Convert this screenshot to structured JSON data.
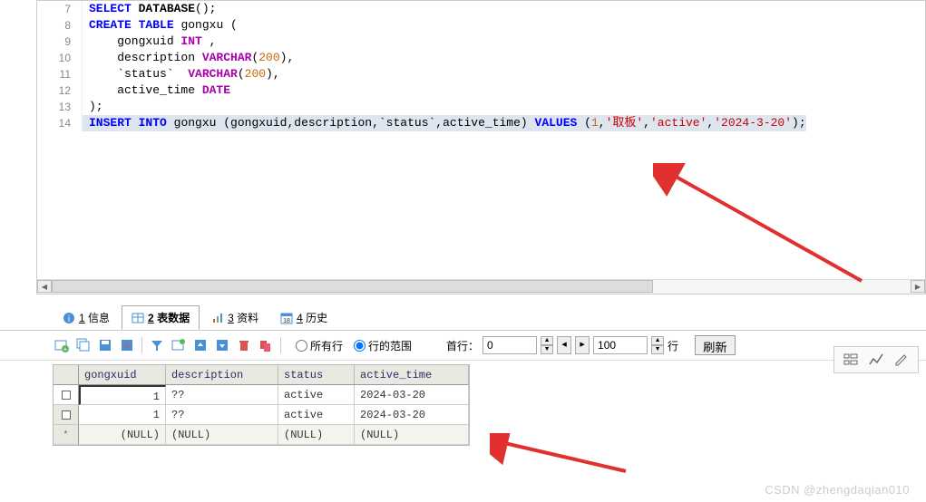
{
  "editor": {
    "lines": [
      {
        "n": 7,
        "segs": [
          {
            "c": "kw",
            "t": "SELECT"
          },
          {
            "t": " "
          },
          {
            "c": "fn",
            "t": "DATABASE"
          },
          {
            "t": "();"
          }
        ]
      },
      {
        "n": 8,
        "segs": [
          {
            "c": "kw",
            "t": "CREATE"
          },
          {
            "t": " "
          },
          {
            "c": "kw",
            "t": "TABLE"
          },
          {
            "t": " gongxu ("
          }
        ]
      },
      {
        "n": 9,
        "segs": [
          {
            "t": "    gongxuid "
          },
          {
            "c": "ty",
            "t": "INT"
          },
          {
            "t": " ,"
          }
        ]
      },
      {
        "n": 10,
        "segs": [
          {
            "t": "    description "
          },
          {
            "c": "ty",
            "t": "VARCHAR"
          },
          {
            "t": "("
          },
          {
            "c": "num",
            "t": "200"
          },
          {
            "t": "),"
          }
        ]
      },
      {
        "n": 11,
        "segs": [
          {
            "t": "    `status`  "
          },
          {
            "c": "ty",
            "t": "VARCHAR"
          },
          {
            "t": "("
          },
          {
            "c": "num",
            "t": "200"
          },
          {
            "t": "),"
          }
        ]
      },
      {
        "n": 12,
        "segs": [
          {
            "t": "    active_time "
          },
          {
            "c": "ty",
            "t": "DATE"
          }
        ]
      },
      {
        "n": 13,
        "segs": [
          {
            "t": ");"
          }
        ]
      },
      {
        "n": 14,
        "hl": true,
        "segs": [
          {
            "c": "kw",
            "t": "INSERT"
          },
          {
            "t": " "
          },
          {
            "c": "kw",
            "t": "INTO"
          },
          {
            "t": " gongxu (gongxuid,description,`status`,active_time) "
          },
          {
            "c": "kw",
            "t": "VALUES"
          },
          {
            "t": " ("
          },
          {
            "c": "num",
            "t": "1"
          },
          {
            "t": ","
          },
          {
            "c": "str",
            "t": "'取板'"
          },
          {
            "t": ","
          },
          {
            "c": "str",
            "t": "'active'"
          },
          {
            "t": ","
          },
          {
            "c": "str",
            "t": "'2024-3-20'"
          },
          {
            "t": ");"
          }
        ]
      }
    ]
  },
  "tabs": {
    "info": {
      "key": "1",
      "label": "信息"
    },
    "data": {
      "key": "2",
      "label": "表数据"
    },
    "profile": {
      "key": "3",
      "label": "资料"
    },
    "history": {
      "key": "4",
      "label": "历史"
    }
  },
  "toolbar": {
    "radio_all": "所有行",
    "radio_range": "行的范围",
    "first_row_label": "首行：",
    "first_row_value": "0",
    "row_count_value": "100",
    "row_suffix": "行",
    "refresh": "刷新"
  },
  "grid": {
    "headers": {
      "c1": "gongxuid",
      "c2": "description",
      "c3": "status",
      "c4": "active_time"
    },
    "rows": [
      {
        "sel": true,
        "c1": "1",
        "c2": "??",
        "c3": "active",
        "c4": "2024-03-20"
      },
      {
        "sel": false,
        "c1": "1",
        "c2": "??",
        "c3": "active",
        "c4": "2024-03-20"
      }
    ],
    "null_text": "(NULL)"
  },
  "watermark": "CSDN @zhengdaqian010"
}
